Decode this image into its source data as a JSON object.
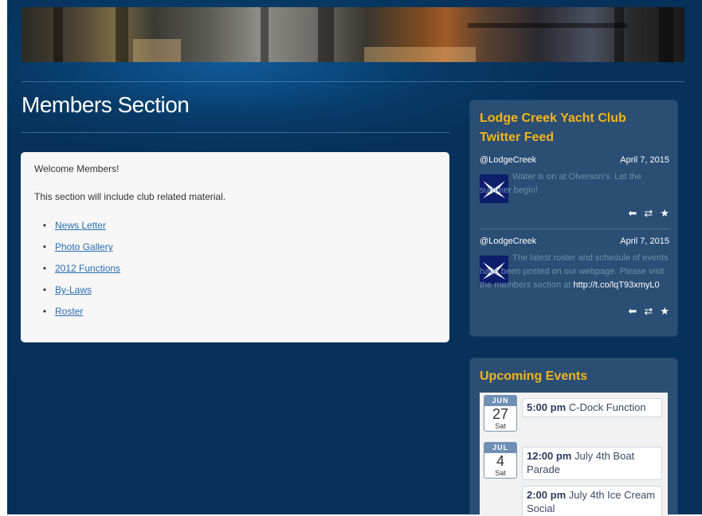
{
  "page": {
    "title": "Members Section"
  },
  "content": {
    "welcome": "Welcome Members!",
    "intro": "This section will include club related material.",
    "links": [
      {
        "label": "News Letter"
      },
      {
        "label": "Photo Gallery"
      },
      {
        "label": "2012 Functions"
      },
      {
        "label": "By-Laws"
      },
      {
        "label": "Roster"
      }
    ]
  },
  "twitter": {
    "title": "Lodge Creek Yacht Club Twitter Feed",
    "tweets": [
      {
        "handle": "@LodgeCreek",
        "date": "April 7, 2015",
        "text": "Water is on at Olverson's. Let the summer begin!",
        "link": ""
      },
      {
        "handle": "@LodgeCreek",
        "date": "April 7, 2015",
        "text": "The latest roster and schedule of events have been posted on our webpage. Please visit the members section at",
        "link": "http://t.co/lqT93xmyL0"
      }
    ],
    "actions": [
      "reply-icon",
      "retweet-icon",
      "favorite-icon"
    ]
  },
  "events": {
    "title": "Upcoming Events",
    "days": [
      {
        "month": "JUN",
        "day": "27",
        "dow": "Sat",
        "items": [
          {
            "time": "5:00 pm",
            "name": "C-Dock Function"
          }
        ]
      },
      {
        "month": "JUL",
        "day": "4",
        "dow": "Sat",
        "items": [
          {
            "time": "12:00 pm",
            "name": "July 4th Boat Parade"
          },
          {
            "time": "2:00 pm",
            "name": "July 4th Ice Cream Social"
          }
        ]
      }
    ]
  },
  "colors": {
    "background": "#05315a",
    "accent": "#f3b51a",
    "link": "#2a6db0",
    "widget": "#2a4e74"
  }
}
